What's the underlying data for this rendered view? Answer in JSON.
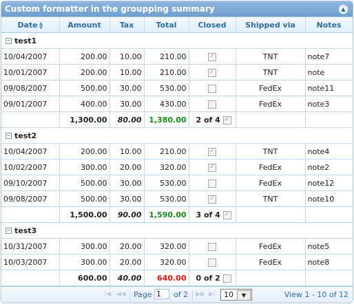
{
  "caption": "Custom formatter in the groupping summary",
  "columns": [
    "Date",
    "Amount",
    "Tax",
    "Total",
    "Closed",
    "Shipped via",
    "Notes"
  ],
  "groups": [
    {
      "name": "test1",
      "rows": [
        {
          "date": "10/04/2007",
          "amount": "200.00",
          "tax": "10.00",
          "total": "210.00",
          "closed": true,
          "ship": "TNT",
          "note": "note7"
        },
        {
          "date": "10/01/2007",
          "amount": "200.00",
          "tax": "10.00",
          "total": "210.00",
          "closed": true,
          "ship": "TNT",
          "note": "note"
        },
        {
          "date": "09/08/2007",
          "amount": "500.00",
          "tax": "30.00",
          "total": "530.00",
          "closed": false,
          "ship": "FedEx",
          "note": "note11"
        },
        {
          "date": "09/01/2007",
          "amount": "400.00",
          "tax": "30.00",
          "total": "430.00",
          "closed": false,
          "ship": "FedEx",
          "note": "note3"
        }
      ],
      "summary": {
        "amount": "1,300.00",
        "tax": "80.00",
        "total": "1,380.00",
        "closed": "2 of 4",
        "closed_checked": true,
        "total_color": "#188c18"
      }
    },
    {
      "name": "test2",
      "rows": [
        {
          "date": "10/04/2007",
          "amount": "200.00",
          "tax": "10.00",
          "total": "210.00",
          "closed": true,
          "ship": "TNT",
          "note": "note4"
        },
        {
          "date": "10/02/2007",
          "amount": "300.00",
          "tax": "20.00",
          "total": "320.00",
          "closed": true,
          "ship": "FedEx",
          "note": "note2"
        },
        {
          "date": "09/10/2007",
          "amount": "500.00",
          "tax": "30.00",
          "total": "530.00",
          "closed": false,
          "ship": "FedEx",
          "note": "note12"
        },
        {
          "date": "09/08/2007",
          "amount": "500.00",
          "tax": "30.00",
          "total": "530.00",
          "closed": true,
          "ship": "TNT",
          "note": "note10"
        }
      ],
      "summary": {
        "amount": "1,500.00",
        "tax": "90.00",
        "total": "1,590.00",
        "closed": "3 of 4",
        "closed_checked": true,
        "total_color": "#188c18"
      }
    },
    {
      "name": "test3",
      "rows": [
        {
          "date": "10/31/2007",
          "amount": "300.00",
          "tax": "20.00",
          "total": "320.00",
          "closed": false,
          "ship": "FedEx",
          "note": "note5"
        },
        {
          "date": "10/03/2007",
          "amount": "300.00",
          "tax": "20.00",
          "total": "320.00",
          "closed": false,
          "ship": "FedEx",
          "note": "note8"
        }
      ],
      "summary": {
        "amount": "600.00",
        "tax": "40.00",
        "total": "640.00",
        "closed": "0 of 2",
        "closed_checked": false,
        "total_color": "#e01010"
      }
    }
  ],
  "pager": {
    "page_label": "Page",
    "page_value": "1",
    "of_label": "of 2",
    "rows_per_page": "10",
    "view_text": "View 1 - 10 of 12"
  },
  "icons": {
    "collapse": "collapse-icon",
    "group_toggle": "minus-square-icon",
    "sort": "sort-icon"
  }
}
